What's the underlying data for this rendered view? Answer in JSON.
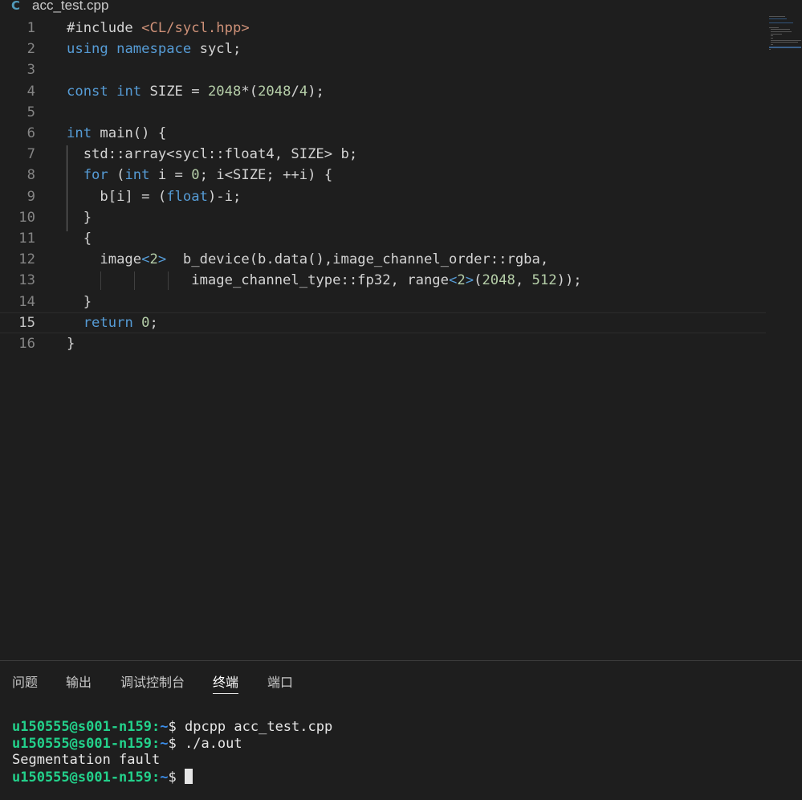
{
  "tab": {
    "icon": "C",
    "icon_name": "cpp-file-icon",
    "filename": "acc_test.cpp"
  },
  "editor": {
    "current_line": 15,
    "lines": [
      {
        "n": "1",
        "tokens": [
          {
            "t": "#include ",
            "c": "def"
          },
          {
            "t": "<CL/sycl.hpp>",
            "c": "str"
          }
        ]
      },
      {
        "n": "2",
        "tokens": [
          {
            "t": "using",
            "c": "kw"
          },
          {
            "t": " ",
            "c": "def"
          },
          {
            "t": "namespace",
            "c": "kw"
          },
          {
            "t": " sycl;",
            "c": "def"
          }
        ]
      },
      {
        "n": "3",
        "tokens": []
      },
      {
        "n": "4",
        "tokens": [
          {
            "t": "const",
            "c": "kw"
          },
          {
            "t": " ",
            "c": "def"
          },
          {
            "t": "int",
            "c": "kw"
          },
          {
            "t": " SIZE = ",
            "c": "def"
          },
          {
            "t": "2048",
            "c": "num"
          },
          {
            "t": "*(",
            "c": "def"
          },
          {
            "t": "2048",
            "c": "num"
          },
          {
            "t": "/",
            "c": "def"
          },
          {
            "t": "4",
            "c": "num"
          },
          {
            "t": ");",
            "c": "def"
          }
        ]
      },
      {
        "n": "5",
        "tokens": []
      },
      {
        "n": "6",
        "tokens": [
          {
            "t": "int",
            "c": "kw"
          },
          {
            "t": " main() {",
            "c": "def"
          }
        ]
      },
      {
        "n": "7",
        "tokens": [
          {
            "t": "  std::array<sycl::float4, SIZE> b;",
            "c": "def"
          }
        ]
      },
      {
        "n": "8",
        "tokens": [
          {
            "t": "  ",
            "c": "def"
          },
          {
            "t": "for",
            "c": "kw"
          },
          {
            "t": " (",
            "c": "def"
          },
          {
            "t": "int",
            "c": "kw"
          },
          {
            "t": " i = ",
            "c": "def"
          },
          {
            "t": "0",
            "c": "num"
          },
          {
            "t": "; i<SIZE; ++i) {",
            "c": "def"
          }
        ]
      },
      {
        "n": "9",
        "tokens": [
          {
            "t": "    b[i] = (",
            "c": "def"
          },
          {
            "t": "float",
            "c": "kw"
          },
          {
            "t": ")-i;",
            "c": "def"
          }
        ]
      },
      {
        "n": "10",
        "tokens": [
          {
            "t": "  }",
            "c": "def"
          }
        ]
      },
      {
        "n": "11",
        "tokens": [
          {
            "t": "  {",
            "c": "def"
          }
        ]
      },
      {
        "n": "12",
        "tokens": [
          {
            "t": "    image",
            "c": "def"
          },
          {
            "t": "<",
            "c": "kw"
          },
          {
            "t": "2",
            "c": "num"
          },
          {
            "t": ">",
            "c": "kw"
          },
          {
            "t": "  b_device(b.data(),image_channel_order::rgba,",
            "c": "def"
          }
        ]
      },
      {
        "n": "13",
        "tokens": [
          {
            "t": "               image_channel_type::fp32, range",
            "c": "def"
          },
          {
            "t": "<",
            "c": "kw"
          },
          {
            "t": "2",
            "c": "num"
          },
          {
            "t": ">",
            "c": "kw"
          },
          {
            "t": "(",
            "c": "def"
          },
          {
            "t": "2048",
            "c": "num"
          },
          {
            "t": ", ",
            "c": "def"
          },
          {
            "t": "512",
            "c": "num"
          },
          {
            "t": "));",
            "c": "def"
          }
        ]
      },
      {
        "n": "14",
        "tokens": [
          {
            "t": "  }",
            "c": "def"
          }
        ]
      },
      {
        "n": "15",
        "tokens": [
          {
            "t": "  ",
            "c": "def"
          },
          {
            "t": "return",
            "c": "kw"
          },
          {
            "t": " ",
            "c": "def"
          },
          {
            "t": "0",
            "c": "num"
          },
          {
            "t": ";",
            "c": "def"
          }
        ]
      },
      {
        "n": "16",
        "tokens": [
          {
            "t": "}",
            "c": "def"
          }
        ]
      }
    ]
  },
  "panel": {
    "tabs": [
      {
        "label": "问题",
        "active": false
      },
      {
        "label": "输出",
        "active": false
      },
      {
        "label": "调试控制台",
        "active": false
      },
      {
        "label": "终端",
        "active": true
      },
      {
        "label": "端口",
        "active": false
      }
    ]
  },
  "terminal": {
    "lines": [
      {
        "user": "u150555@s001-n159",
        "sep": ":",
        "path": "~",
        "prompt": "$ ",
        "cmd": "dpcpp acc_test.cpp"
      },
      {
        "user": "u150555@s001-n159",
        "sep": ":",
        "path": "~",
        "prompt": "$ ",
        "cmd": "./a.out"
      },
      {
        "output": "Segmentation fault"
      },
      {
        "user": "u150555@s001-n159",
        "sep": ":",
        "path": "~",
        "prompt": "$ ",
        "cmd": "",
        "cursor": true
      }
    ]
  },
  "colors": {
    "background": "#1e1e1e",
    "keyword": "#569cd6",
    "number": "#b5cea8",
    "string": "#ce9178",
    "terminal_user": "#23d18b",
    "terminal_path": "#3b8eea"
  }
}
